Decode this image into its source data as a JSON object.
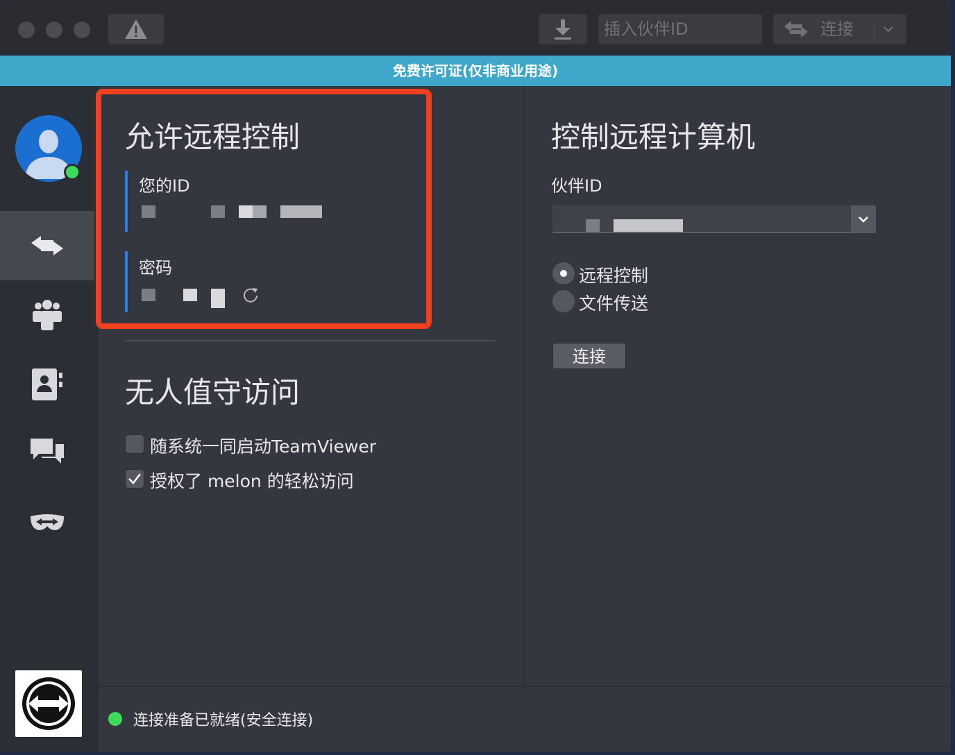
{
  "toolbar": {
    "partner_id_placeholder": "插入伙伴ID",
    "connect_label": "连接"
  },
  "banner": {
    "text": "免费许可证(仅非商业用途)"
  },
  "allow_remote": {
    "title": "允许远程控制",
    "your_id_label": "您的ID",
    "password_label": "密码"
  },
  "unattended": {
    "title": "无人值守访问",
    "start_with_system_label": "随系统一同启动TeamViewer",
    "start_with_system_checked": false,
    "easy_access_label": "授权了 melon 的轻松访问",
    "easy_access_checked": true
  },
  "control_remote": {
    "title": "控制远程计算机",
    "partner_id_label": "伙伴ID",
    "mode_remote_control": "远程控制",
    "mode_file_transfer": "文件传送",
    "selected_mode": "远程控制",
    "connect_button": "连接"
  },
  "status": {
    "text": "连接准备已就绪(安全连接)",
    "color": "#3ddb5a"
  },
  "colors": {
    "banner": "#3fa7c9",
    "highlight_border": "#f1401d",
    "accent_bar": "#2a7fde"
  }
}
